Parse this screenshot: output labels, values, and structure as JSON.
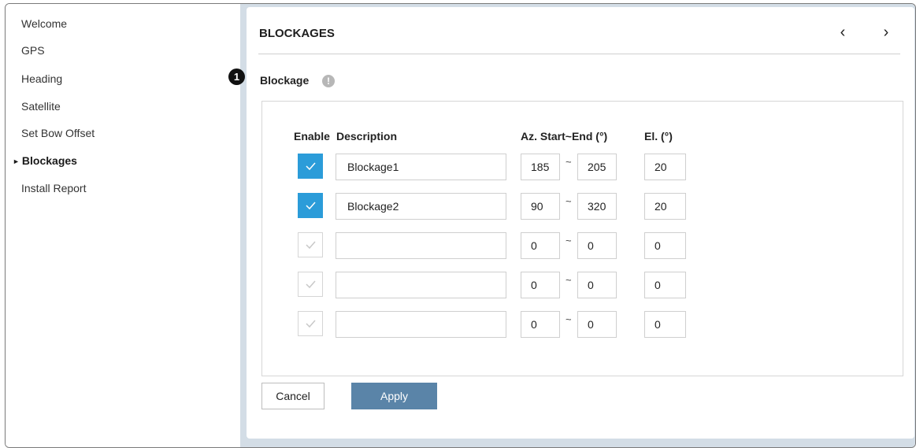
{
  "sidebar": {
    "items": [
      {
        "label": "Welcome"
      },
      {
        "label": "GPS"
      },
      {
        "label": "Heading"
      },
      {
        "label": "Satellite"
      },
      {
        "label": "Set Bow Offset"
      },
      {
        "label": "Blockages",
        "active": true
      },
      {
        "label": "Install Report"
      }
    ]
  },
  "panel": {
    "title": "BLOCKAGES",
    "prev_icon": "chevron-left-icon",
    "next_icon": "chevron-right-icon",
    "prev_glyph": "‹",
    "next_glyph": "›"
  },
  "badge": "1",
  "section": {
    "label": "Blockage",
    "info_icon": "info-icon",
    "info_glyph": "!"
  },
  "table": {
    "headers": {
      "enable": "Enable",
      "description": "Description",
      "az": "Az. Start~End (°)",
      "el": "El. (°)"
    },
    "tilde": "~",
    "rows": [
      {
        "enabled": true,
        "description": "Blockage1",
        "az_start": "185",
        "az_end": "205",
        "el": "20"
      },
      {
        "enabled": true,
        "description": "Blockage2",
        "az_start": "90",
        "az_end": "320",
        "el": "20"
      },
      {
        "enabled": false,
        "description": "",
        "az_start": "0",
        "az_end": "0",
        "el": "0"
      },
      {
        "enabled": false,
        "description": "",
        "az_start": "0",
        "az_end": "0",
        "el": "0"
      },
      {
        "enabled": false,
        "description": "",
        "az_start": "0",
        "az_end": "0",
        "el": "0"
      }
    ]
  },
  "buttons": {
    "cancel": "Cancel",
    "apply": "Apply"
  },
  "colors": {
    "checkbox_on": "#2b9cd9",
    "apply_button": "#5a84a8",
    "content_background": "#d3dde6"
  }
}
